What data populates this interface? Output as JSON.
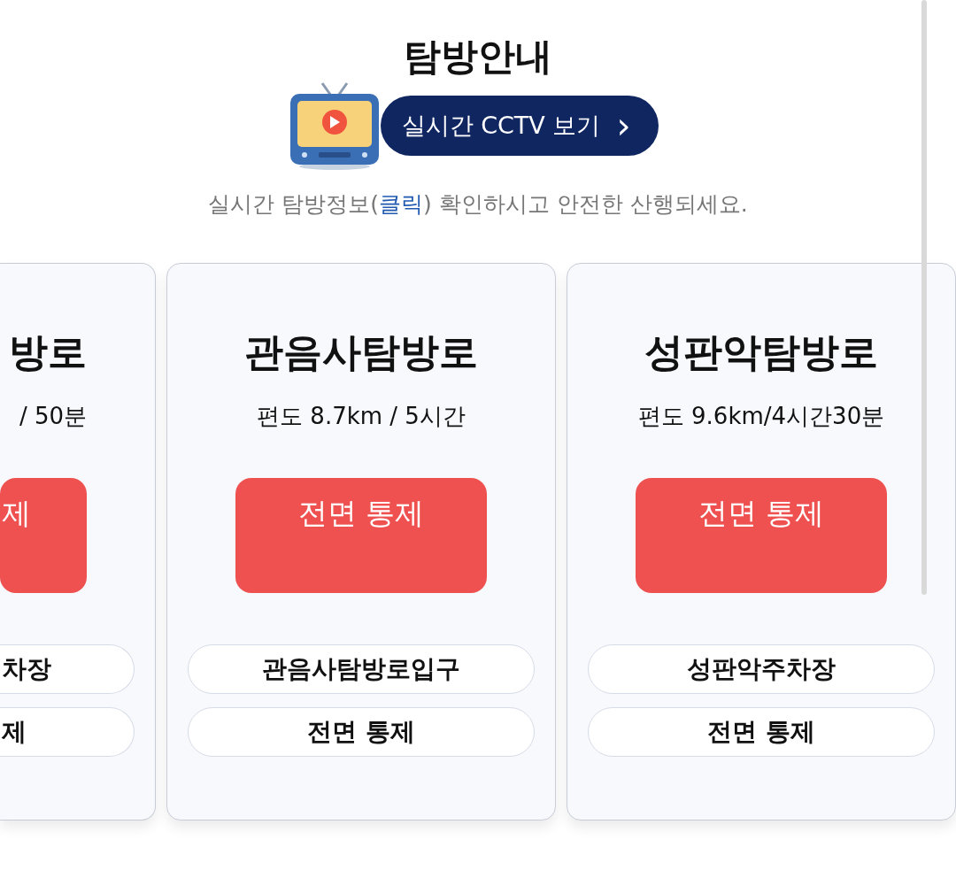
{
  "header": {
    "title": "탐방안내",
    "cctv_button": "실시간 CCTV 보기",
    "cctv_arrow": "›",
    "notice_parts": [
      "실시간 탐방정보(",
      "클릭",
      ") 확인하시고 안전한 산행되세요."
    ]
  },
  "cards": [
    {
      "partial": true,
      "title": "방로",
      "distance": "/ 50분",
      "status": "제",
      "closed": true,
      "place": "차장",
      "place_status": "제"
    },
    {
      "partial": false,
      "title": "관음사탐방로",
      "distance": "편도 8.7km / 5시간",
      "status": "전면 통제",
      "closed": true,
      "place": "관음사탐방로입구",
      "place_status": "전면 통제"
    },
    {
      "partial": false,
      "title": "성판악탐방로",
      "distance": "편도 9.6km/4시간30분",
      "status": "전면 통제",
      "closed": true,
      "place": "성판악주차장",
      "place_status": "전면 통제"
    }
  ]
}
